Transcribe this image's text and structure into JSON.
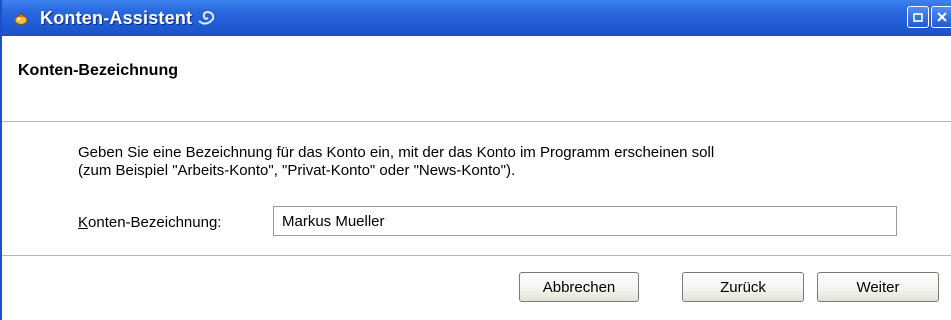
{
  "window": {
    "title": "Konten-Assistent",
    "icons": {
      "app": "app-icon",
      "title_decoration": "swirl-icon",
      "restore": "restore-icon",
      "close": "close-icon"
    },
    "colors": {
      "titlebar": "#1f5bd6",
      "background": "#ffffff"
    }
  },
  "header": {
    "title": "Konten-Bezeichnung"
  },
  "content": {
    "description_line1": "Geben Sie eine Bezeichnung für das Konto ein, mit der das Konto im Programm erscheinen soll",
    "description_line2": "(zum Beispiel \"Arbeits-Konto\", \"Privat-Konto\" oder \"News-Konto\").",
    "field_label_first": "K",
    "field_label_rest": "onten-Bezeichnung:",
    "field_value": "Markus Mueller"
  },
  "footer": {
    "cancel_label": "Abbrechen",
    "back_label": "Zurück",
    "next_label": "Weiter"
  }
}
